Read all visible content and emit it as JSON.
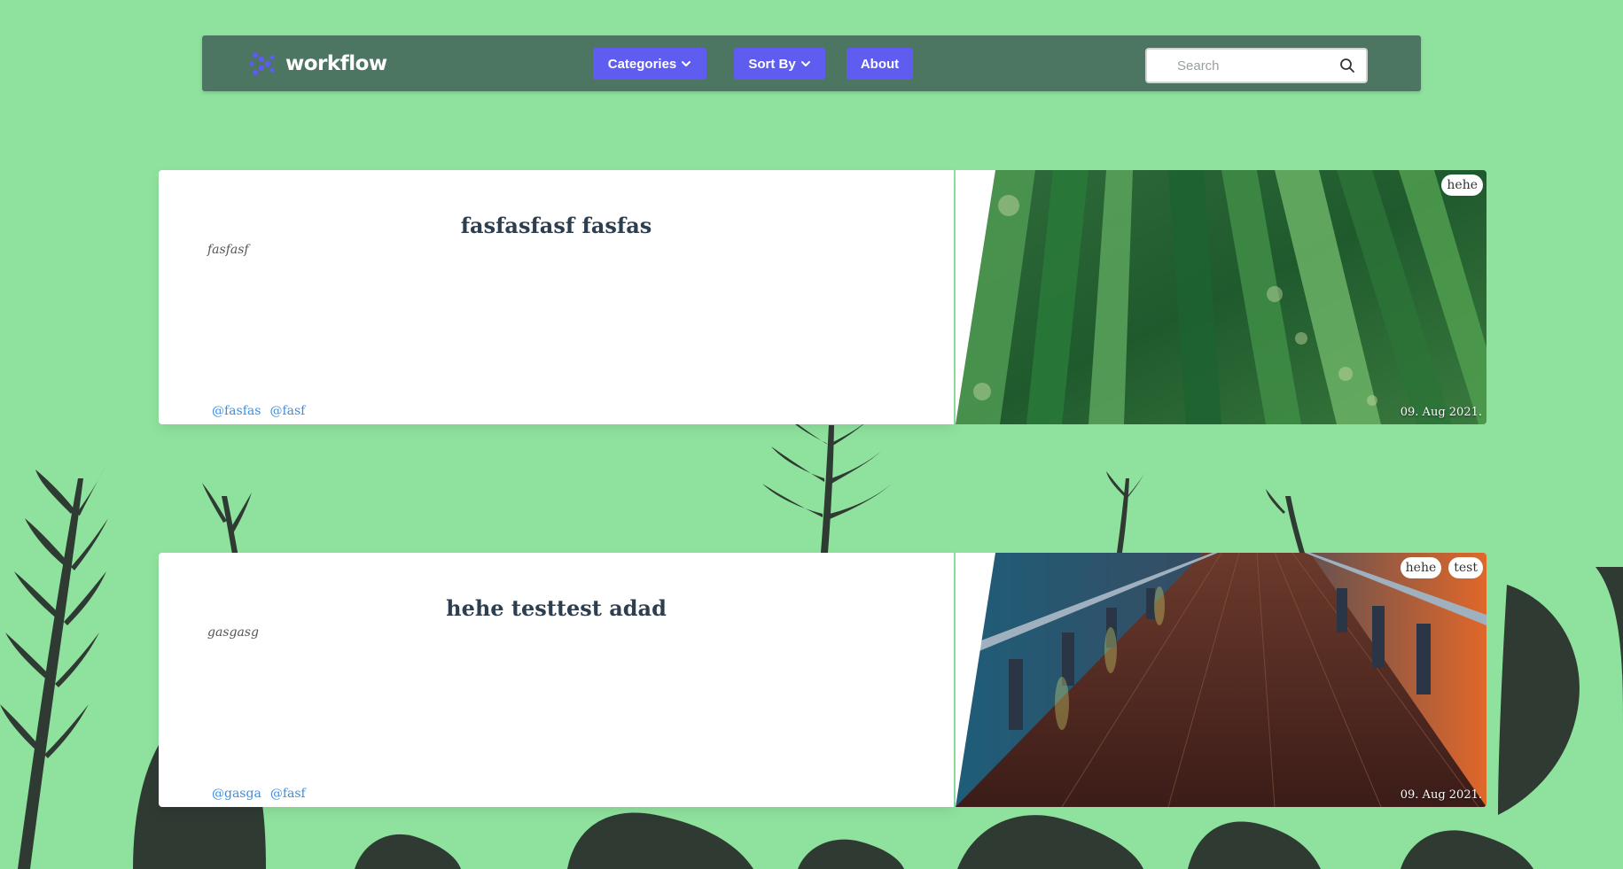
{
  "header": {
    "brand": "workflow",
    "nav": {
      "categories_label": "Categories",
      "sort_label": "Sort By",
      "about_label": "About"
    },
    "search": {
      "placeholder": "Search",
      "value": ""
    }
  },
  "posts": [
    {
      "title": "fasfasfasf fasfas",
      "subtitle": "fasfasf",
      "tags": [
        "@fasfas",
        "@fasf"
      ],
      "badges": [
        "hehe"
      ],
      "date": "09. Aug 2021.",
      "image": "green-leaves-closeup"
    },
    {
      "title": "hehe testtest adad",
      "subtitle": "gasgasg",
      "tags": [
        "@gasga",
        "@fasf"
      ],
      "badges": [
        "hehe",
        "test"
      ],
      "date": "09. Aug 2021.",
      "image": "wooden-pier-sunset"
    }
  ],
  "colors": {
    "background": "#8fe29e",
    "navbar": "#4c7562",
    "accent": "#5e5df0",
    "title": "#2c3e50",
    "tag": "#3b8de0"
  },
  "icons": {
    "logo": "workflow-logo-icon",
    "chevron": "chevron-down-icon",
    "search": "search-icon"
  }
}
